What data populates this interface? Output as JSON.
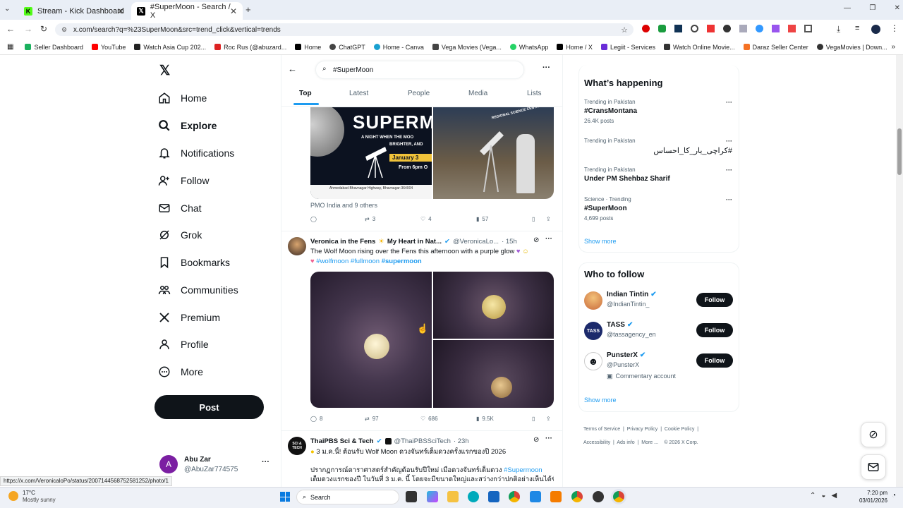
{
  "browser": {
    "tabs": [
      {
        "title": "Stream - Kick Dashboard",
        "color": "#53fc18"
      },
      {
        "title": "#SuperMoon - Search / X",
        "color": "#000000"
      }
    ],
    "url": "x.com/search?q=%23SuperMoon&src=trend_click&vertical=trends",
    "bookmarks": [
      "Seller Dashboard",
      "YouTube",
      "Watch Asia Cup 202...",
      "Roc Rus (@abuzard...",
      "Home",
      "ChatGPT",
      "Home - Canva",
      "Vega Movies (Vega...",
      "WhatsApp",
      "Home / X",
      "Legiit - Services",
      "Watch Online Movie...",
      "Daraz Seller Center",
      "VegaMovies | Down..."
    ],
    "status_url": "https://x.com/VeronicaloPo/status/2007144568752581252/photo/1"
  },
  "nav": {
    "items": [
      {
        "label": "Home",
        "icon": "home-icon"
      },
      {
        "label": "Explore",
        "icon": "search-icon"
      },
      {
        "label": "Notifications",
        "icon": "bell-icon"
      },
      {
        "label": "Follow",
        "icon": "add-user-icon"
      },
      {
        "label": "Chat",
        "icon": "mail-icon"
      },
      {
        "label": "Grok",
        "icon": "grok-icon"
      },
      {
        "label": "Bookmarks",
        "icon": "bookmark-icon"
      },
      {
        "label": "Communities",
        "icon": "people-icon"
      },
      {
        "label": "Premium",
        "icon": "x-icon"
      },
      {
        "label": "Profile",
        "icon": "person-icon"
      },
      {
        "label": "More",
        "icon": "more-icon"
      }
    ],
    "post_label": "Post",
    "account": {
      "name": "Abu Zar",
      "handle": "@AbuZar774575",
      "initial": "A"
    }
  },
  "search": {
    "query": "#SuperMoon",
    "tabs": [
      "Top",
      "Latest",
      "People",
      "Media",
      "Lists"
    ]
  },
  "tweets": [
    {
      "image_text": {
        "title": "SUPERM",
        "line1": "A NIGHT WHEN THE MOO",
        "line2": "BRIGHTER, AND",
        "date": "January 3",
        "time": "From 6pm O",
        "address": "Ahmedabad-Bhavnagar Highway, Bhavnagar-364004",
        "sign": "REGIONAL SCIENCE CENTRE"
      },
      "liked_by": "PMO India and 9 others",
      "stats": {
        "replies": "",
        "reposts": "3",
        "likes": "4",
        "views": "57"
      }
    },
    {
      "author": "Veronica in the Fens",
      "author_suffix": "My Heart in Nat...",
      "handle": "@VeronicaLo...",
      "time": "· 15h",
      "text": "The Wolf Moon rising over the Fens this afternoon with a purple glow",
      "hashtags": "#wolfmoon #fullmoon",
      "hashtag_bold": "#supermoon",
      "stats": {
        "replies": "8",
        "reposts": "97",
        "likes": "686",
        "views": "9.5K"
      }
    },
    {
      "author": "ThaiPBS Sci & Tech",
      "handle": "@ThaiPBSSciTech",
      "time": "· 23h",
      "line1": "3 ม.ค.นี้! ต้อนรับ Wolf Moon ดวงจันทร์เต็มดวงครั้งแรกของปี 2026",
      "line2": "ปรากฏการณ์ดาราศาสตร์สำคัญต้อนรับปีใหม่ เมื่อดวงจันทร์เต็มดวง",
      "line2_tag": "#Supermoon",
      "line3": "เต็มดวงแรกของปี ในวันที่ 3 ม.ค. นี้ โดยจะมีขนาดใหญ่และสว่างกว่าปกติอย่างเห็นได้ชัด",
      "avatar_text": "SCI & TECH"
    }
  ],
  "trending": {
    "header": "What’s happening",
    "items": [
      {
        "meta": "Trending in Pakistan",
        "title": "#CransMontana",
        "count": "26.4K posts"
      },
      {
        "meta": "Trending in Pakistan",
        "title": "#کراچی_یار_کا_احساس",
        "count": ""
      },
      {
        "meta": "Trending in Pakistan",
        "title": "Under PM Shehbaz Sharif",
        "count": ""
      },
      {
        "meta": "Science · Trending",
        "title": "#SuperMoon",
        "count": "4,699 posts"
      }
    ],
    "show_more": "Show more"
  },
  "who_to_follow": {
    "header": "Who to follow",
    "items": [
      {
        "name": "Indian Tintin",
        "handle": "@IndianTintin_",
        "extra": ""
      },
      {
        "name": "TASS",
        "handle": "@tassagency_en",
        "extra": ""
      },
      {
        "name": "PunsterX",
        "handle": "@PunsterX",
        "extra": "Commentary account"
      }
    ],
    "follow_label": "Follow",
    "show_more": "Show more"
  },
  "footer": {
    "links": [
      "Terms of Service",
      "Privacy Policy",
      "Cookie Policy",
      "Accessibility",
      "Ads info",
      "More ...",
      "© 2026 X Corp."
    ]
  },
  "taskbar": {
    "weather_temp": "17°C",
    "weather_desc": "Mostly sunny",
    "search": "Search",
    "time": "7:20 pm",
    "date": "03/01/2026"
  }
}
